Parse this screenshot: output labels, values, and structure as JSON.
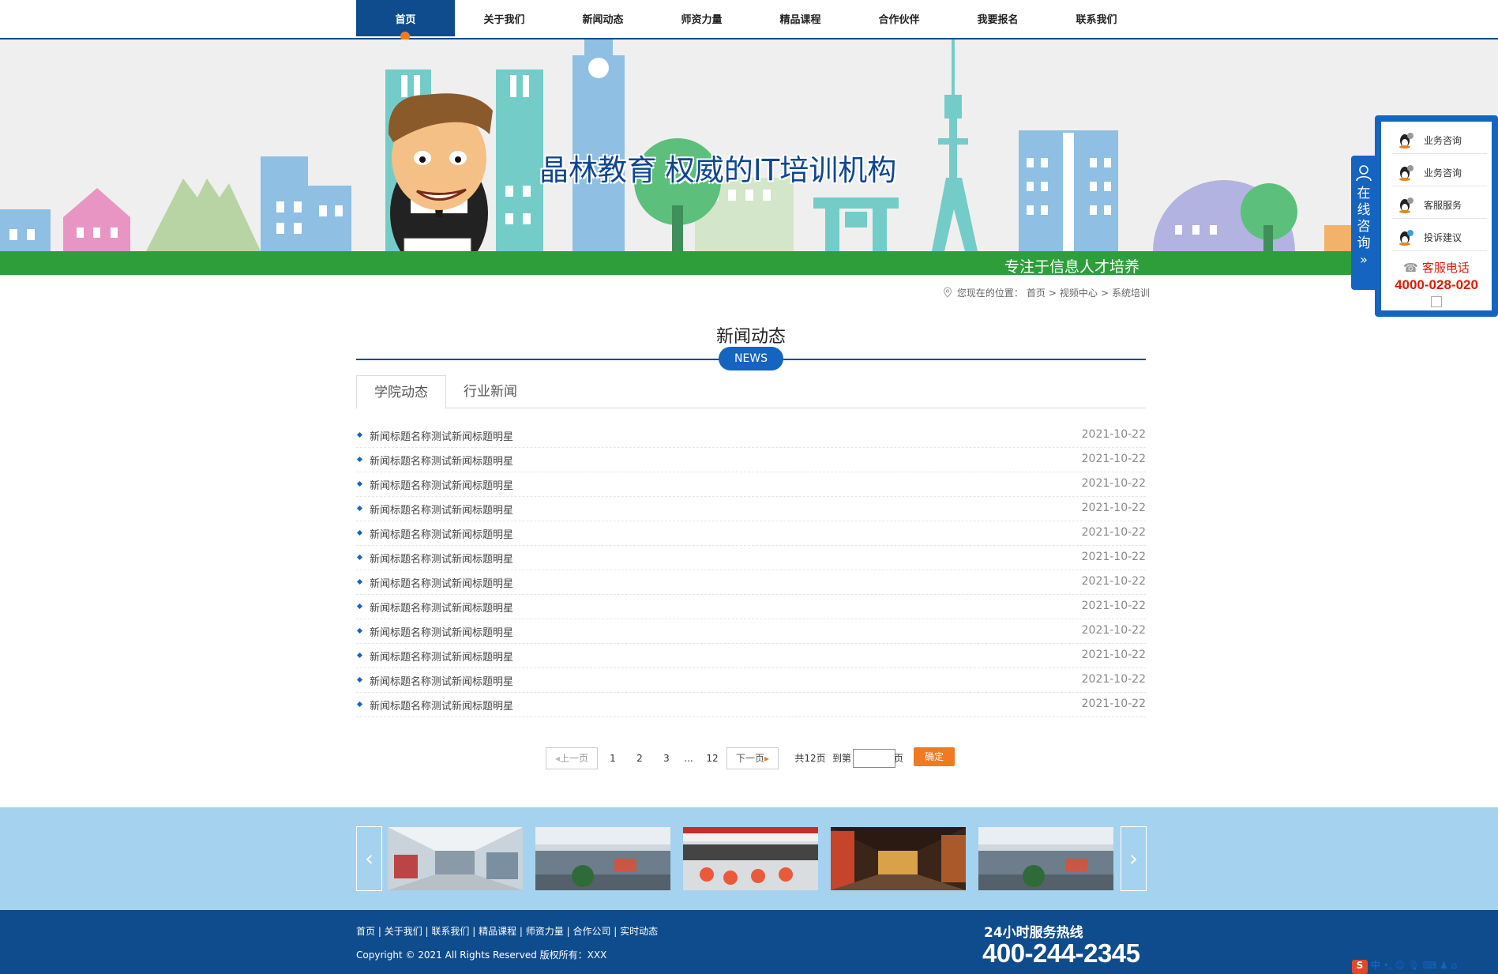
{
  "nav": {
    "items": [
      "首页",
      "关于我们",
      "新闻动态",
      "师资力量",
      "精品课程",
      "合作伙伴",
      "我要报名",
      "联系我们"
    ]
  },
  "banner": {
    "title": "晶林教育 权威的IT培训机构",
    "subtitle": "专注于信息人才培养"
  },
  "breadcrumb": {
    "prefix": "您现在的位置：",
    "items": [
      "首页",
      "视频中心",
      "系统培训"
    ],
    "sep": ">"
  },
  "section": {
    "title": "新闻动态",
    "badge": "NEWS"
  },
  "tabs": [
    "学院动态",
    "行业新闻"
  ],
  "news": [
    {
      "title": "新闻标题名称测试新闻标题明星",
      "date": "2021-10-22"
    },
    {
      "title": "新闻标题名称测试新闻标题明星",
      "date": "2021-10-22"
    },
    {
      "title": "新闻标题名称测试新闻标题明星",
      "date": "2021-10-22"
    },
    {
      "title": "新闻标题名称测试新闻标题明星",
      "date": "2021-10-22"
    },
    {
      "title": "新闻标题名称测试新闻标题明星",
      "date": "2021-10-22"
    },
    {
      "title": "新闻标题名称测试新闻标题明星",
      "date": "2021-10-22"
    },
    {
      "title": "新闻标题名称测试新闻标题明星",
      "date": "2021-10-22"
    },
    {
      "title": "新闻标题名称测试新闻标题明星",
      "date": "2021-10-22"
    },
    {
      "title": "新闻标题名称测试新闻标题明星",
      "date": "2021-10-22"
    },
    {
      "title": "新闻标题名称测试新闻标题明星",
      "date": "2021-10-22"
    },
    {
      "title": "新闻标题名称测试新闻标题明星",
      "date": "2021-10-22"
    },
    {
      "title": "新闻标题名称测试新闻标题明星",
      "date": "2021-10-22"
    }
  ],
  "pager": {
    "prev": "上一页",
    "pages": [
      "1",
      "2",
      "3",
      "...",
      "12"
    ],
    "next": "下一页",
    "total": "共12页",
    "goto_prefix": "到第",
    "goto_suffix": "页",
    "confirm": "确定",
    "goto_value": ""
  },
  "footer": {
    "links": [
      "首页",
      "关于我们",
      "联系我们",
      "精品课程",
      "师资力量",
      "合作公司",
      "实时动态"
    ],
    "copyright": "Copyright © 2021 All Rights Reserved 版权所有：XXX",
    "hotline_label": "24小时服务热线",
    "hotline": "400-244-2345"
  },
  "side": {
    "tab_label": [
      "在",
      "线",
      "咨",
      "询"
    ],
    "items": [
      "业务咨询",
      "业务咨询",
      "客服服务",
      "投诉建议"
    ],
    "phone_label": "客服电话",
    "phone": "4000-028-020"
  },
  "ime": {
    "label": "中"
  },
  "colors": {
    "primary": "#0f4c8d",
    "accent_blue": "#1564c0",
    "accent_orange": "#f07a20",
    "banner_green": "#2e9e3b",
    "strip_bg": "#a5d2ee",
    "phone_red": "#d81e06"
  }
}
